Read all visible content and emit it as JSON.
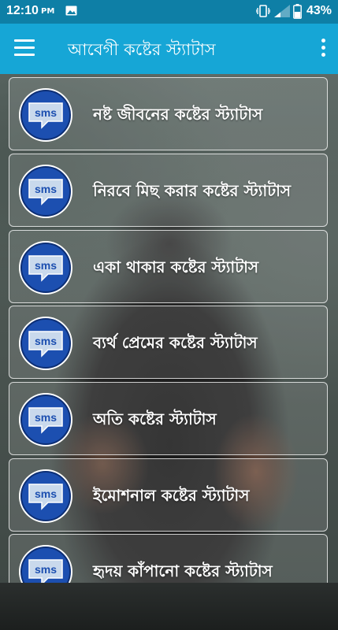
{
  "status_bar": {
    "time": "12:10",
    "ampm": "PM",
    "battery": "43%",
    "icons": [
      "image-icon",
      "vibrate-icon",
      "signal-icon",
      "battery-icon"
    ]
  },
  "app_bar": {
    "title": "আবেগী কষ্টের স্ট্যাটাস",
    "menu_icon": "hamburger-menu-icon",
    "overflow_icon": "more-vert-icon"
  },
  "list": {
    "item_icon": "sms-icon",
    "items": [
      {
        "label": "নষ্ট জীবনের কষ্টের স্ট্যাটাস"
      },
      {
        "label": "নিরবে মিছ করার কষ্টের স্ট্যাটাস"
      },
      {
        "label": "একা থাকার কষ্টের স্ট্যাটাস"
      },
      {
        "label": "ব্যর্থ প্রেমের কষ্টের স্ট্যাটাস"
      },
      {
        "label": "অতি কষ্টের স্ট্যাটাস"
      },
      {
        "label": "ইমোশনাল কষ্টের স্ট্যাটাস"
      },
      {
        "label": "হৃদয় কাঁপানো কষ্টের স্ট্যাটাস"
      }
    ]
  },
  "colors": {
    "status_bar": "#0e7fa6",
    "app_bar": "#16a6d6",
    "avatar_ring": "#1c4fb0",
    "bubble_fill": "#c9d9ec"
  }
}
